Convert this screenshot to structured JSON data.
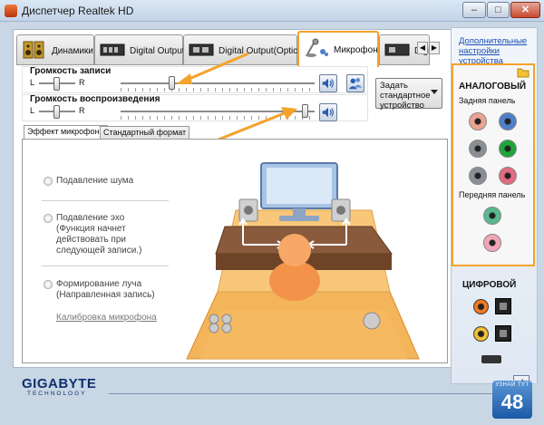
{
  "window": {
    "title": "Диспетчер Realtek HD",
    "controls": {
      "minimize": "–",
      "maximize": "□",
      "close": "✕"
    }
  },
  "tabs": [
    {
      "label": "Динамики",
      "icon": "speaker-icon"
    },
    {
      "label": "Digital Output",
      "icon": "digital-output-icon"
    },
    {
      "label": "Digital Output(Optical)",
      "icon": "optical-output-icon"
    },
    {
      "label": "Микрофон",
      "icon": "microphone-icon",
      "active": true
    },
    {
      "label": "Digi",
      "icon": "digital-output-icon"
    }
  ],
  "record_volume": {
    "title": "Громкость записи",
    "left": "L",
    "right": "R",
    "balance": 0.5,
    "level": 0.26
  },
  "playback_volume": {
    "title": "Громкость воспроизведения",
    "left": "L",
    "right": "R",
    "balance": 0.5,
    "level": 0.95
  },
  "default_device": {
    "label": "Задать стандартное устройство"
  },
  "subtabs": [
    {
      "label": "Эффект микрофона",
      "active": true
    },
    {
      "label": "Стандартный формат"
    }
  ],
  "options": {
    "noise": "Подавление шума",
    "echo": "Подавление эхо (Функция начнет действовать при следующей записи.)",
    "beam": "Формирование луча (Направленная запись)"
  },
  "calibration_link": "Калибровка микрофона",
  "sidebar": {
    "advanced_link": "Дополнительные настройки устройства",
    "analog_title": "АНАЛОГОВЫЙ",
    "back_panel": "Задняя панель",
    "front_panel": "Передняя панель",
    "digital_title": "ЦИФРОВОЙ"
  },
  "jack_colors": {
    "back": [
      "#e9a38f",
      "#4f7fc8",
      "#8a8f95",
      "#1fa63b",
      "#8a8f95",
      "#e36a80"
    ],
    "front": [
      "#57b98d",
      "#f0a6b6"
    ]
  },
  "footer": {
    "brand": "GIGABYTE",
    "brand_sub": "TECHNOLOGY",
    "badge_small": "УЗНАЙ ТУТ",
    "badge_number": "48",
    "ok": "✓"
  },
  "accent": "#f3a32c"
}
